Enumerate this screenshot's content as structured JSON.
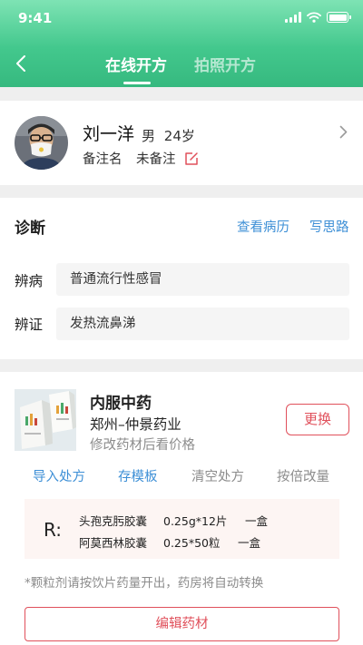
{
  "status_bar": {
    "time": "9:41"
  },
  "nav": {
    "tabs": [
      {
        "label": "在线开方",
        "active": true
      },
      {
        "label": "拍照开方",
        "active": false
      }
    ]
  },
  "patient": {
    "name": "刘一洋",
    "gender": "男",
    "age": "24岁",
    "remark_label": "备注名",
    "remark_value": "未备注"
  },
  "diagnosis": {
    "title": "诊断",
    "links": {
      "history": "查看病历",
      "notes": "写思路"
    },
    "fields": [
      {
        "label": "辨病",
        "value": "普通流行性感冒"
      },
      {
        "label": "辨证",
        "value": "发热流鼻涕"
      }
    ]
  },
  "prescription": {
    "type": "内服中药",
    "pharmacy": "郑州–仲景药业",
    "price_hint": "修改药材后看价格",
    "change_button": "更换",
    "actions": [
      {
        "label": "导入处方",
        "state": "active"
      },
      {
        "label": "存模板",
        "state": "active"
      },
      {
        "label": "清空处方",
        "state": "muted"
      },
      {
        "label": "按倍改量",
        "state": "muted"
      }
    ],
    "rx_symbol": "R:",
    "drugs": [
      {
        "name": "头孢克肟胶囊",
        "spec": "0.25g*12片",
        "qty": "一盒"
      },
      {
        "name": "阿莫西林胶囊",
        "spec": "0.25*50粒",
        "qty": "一盒"
      }
    ],
    "note": "*颗粒剂请按饮片药量开出，药房将自动转换",
    "edit_button": "编辑药材"
  },
  "colors": {
    "header_green": "#43c88d",
    "link_blue": "#3d8fd6",
    "accent_red": "#e0505b",
    "muted_gray": "#8c8c8c"
  },
  "icons": [
    "back-icon",
    "signal-icon",
    "wifi-icon",
    "battery-icon",
    "edit-icon",
    "chevron-right-icon"
  ]
}
